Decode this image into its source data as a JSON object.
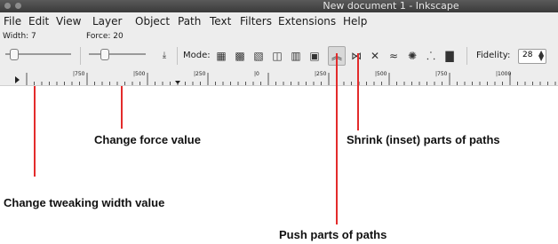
{
  "window": {
    "title": "New document 1 - Inkscape"
  },
  "menubar": {
    "items": [
      "File",
      "Edit",
      "View",
      "Layer",
      "Object",
      "Path",
      "Text",
      "Filters",
      "Extensions",
      "Help"
    ]
  },
  "toolbar": {
    "width_label": "Width: 7",
    "width_value": 0.07,
    "force_label": "Force: 20",
    "force_value": 0.2,
    "mode_label": "Mode:",
    "mode_icons": [
      "move-objects-icon",
      "move-in-out-icon",
      "move-jitter-icon",
      "scale-objects-icon",
      "rotate-objects-icon",
      "duplicate-objects-icon",
      "push-paths-icon",
      "shrink-paths-icon",
      "attract-repel-icon",
      "roughen-icon",
      "paint-color-icon",
      "jitter-color-icon",
      "blur-icon"
    ],
    "active_mode": "push-paths-icon",
    "fidelity_label": "Fidelity:",
    "fidelity_value": "28"
  },
  "ruler": {
    "labels": [
      "|750",
      "|500",
      "|250",
      "|0",
      "|250",
      "|500",
      "|750",
      "|1000"
    ]
  },
  "annotations": {
    "force": "Change force value",
    "shrink": "Shrink (inset) parts of paths",
    "width": "Change tweaking width value",
    "push": "Push parts of paths"
  },
  "colors": {
    "callout_line": "#e32b2b",
    "titlebar": "#444444",
    "toolbar_bg": "#ededed"
  }
}
